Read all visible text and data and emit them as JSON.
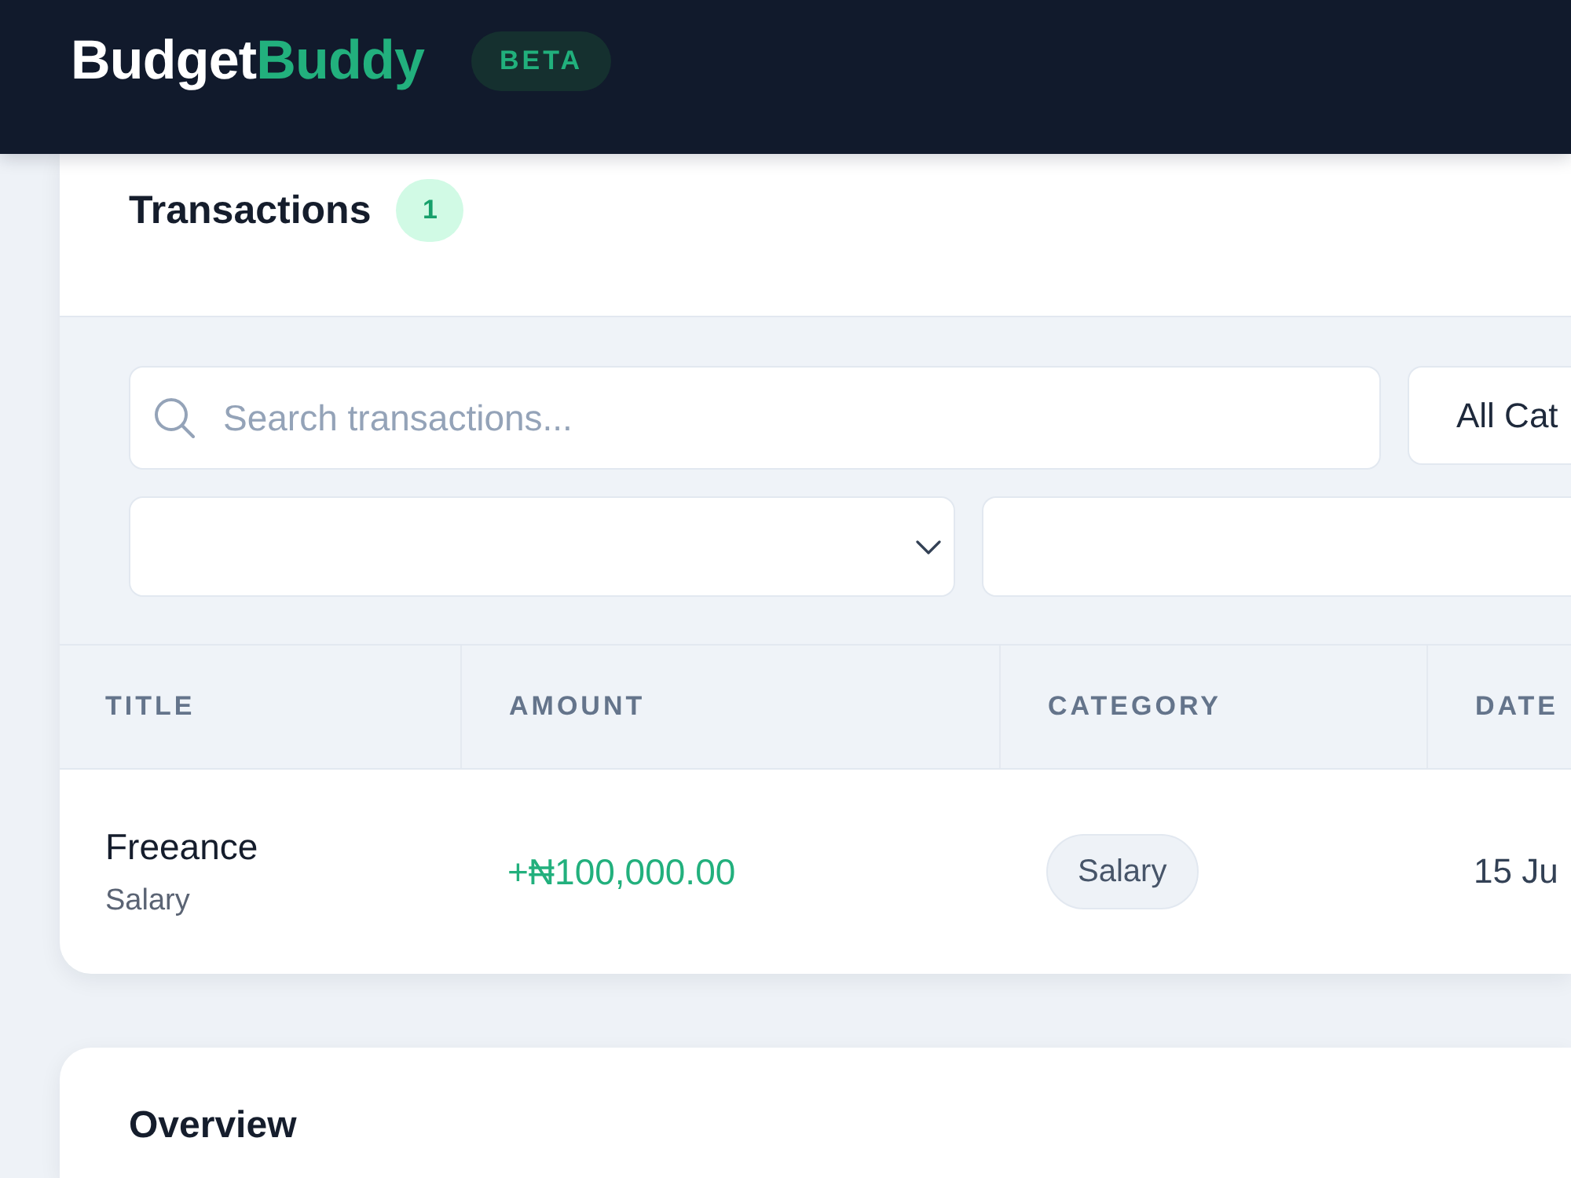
{
  "header": {
    "logo": [
      "Budget",
      "Buddy"
    ],
    "badge": "BETA"
  },
  "transactions": {
    "title": "Transactions",
    "count": "1",
    "filter_rows": [
      [
        {
          "kind": "search",
          "placeholder": "Search transactions..."
        },
        {
          "kind": "select",
          "value": "All Cat",
          "caret": false
        }
      ],
      [
        {
          "kind": "select",
          "caret": true
        },
        {
          "kind": "input"
        }
      ]
    ],
    "table": {
      "columns": [
        "TITLE",
        "AMOUNT",
        "CATEGORY",
        "DATE"
      ],
      "rows": [
        {
          "title": "Freeance",
          "subtitle": "Salary",
          "amount": "+₦100,000.00",
          "kind": "income",
          "category": "Salary",
          "date": "15 Ju"
        }
      ]
    }
  },
  "overview": {
    "title": "Overview"
  }
}
